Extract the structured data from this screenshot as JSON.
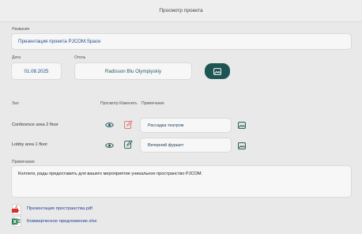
{
  "window": {
    "title": "Просмотр проекта"
  },
  "form": {
    "name_label": "Название",
    "name_value": "Презентация проекта PJCOM.Space",
    "date_label": "Дата",
    "date_value": "01.08.2025",
    "hotel_label": "Отель",
    "hotel_value": "Radisson Blu Olympiyskiy"
  },
  "halls": {
    "headers": {
      "hall": "Зал",
      "view": "Просмотр",
      "edit": "Изменить",
      "note": "Примечание"
    },
    "rows": [
      {
        "name": "Conference area 2 floor",
        "note": "Рассадка театром"
      },
      {
        "name": "Lobby area 1 floor",
        "note": "Вечерний фуршет"
      }
    ]
  },
  "note": {
    "label": "Примечание",
    "text": "Коллеги, рады предоставить для вашего мероприятие уникальное пространство PJCOM."
  },
  "files": [
    {
      "name": "Презентация пространства.pdf",
      "icon": "pdf-file-icon"
    },
    {
      "name": "Коммерческое предложение.xlsx",
      "icon": "excel-file-icon"
    }
  ],
  "colors": {
    "accent": "#1e5552",
    "text_blue": "#1f4e87",
    "link": "#1f3f99",
    "edit_red": "#e06a6a"
  }
}
